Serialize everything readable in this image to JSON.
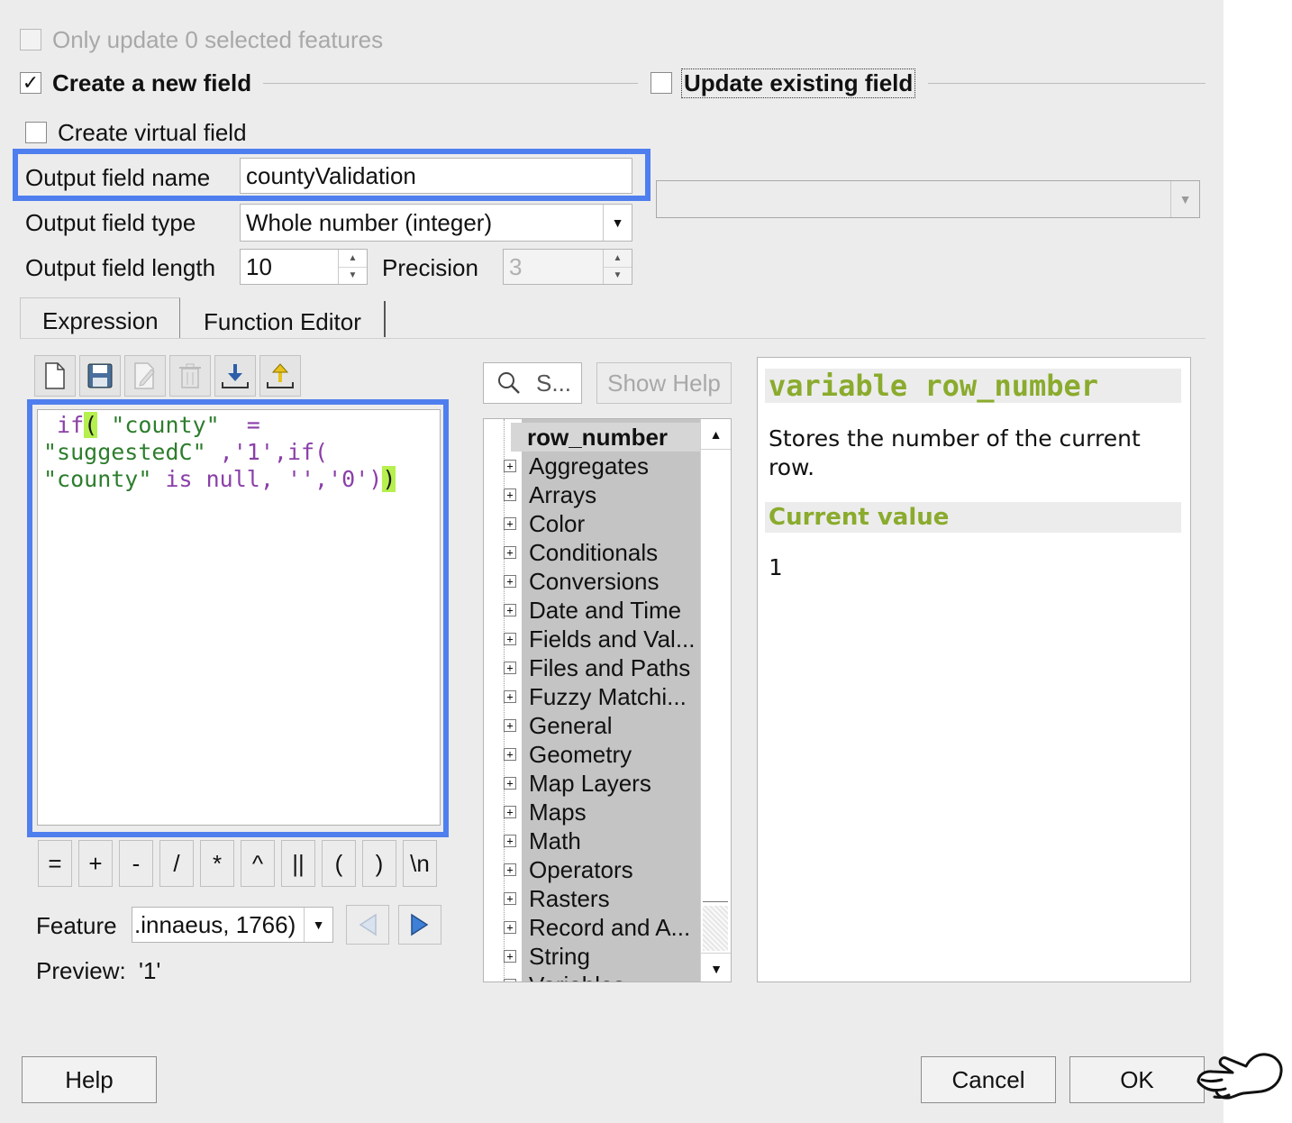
{
  "options": {
    "only_update_label": "Only update 0 selected features",
    "create_new_field_label": "Create a new field",
    "update_existing_label": "Update existing field",
    "create_virtual_label": "Create virtual field"
  },
  "output": {
    "name_label": "Output field name",
    "name_value": "countyValidation",
    "type_label": "Output field type",
    "type_value": "Whole number (integer)",
    "length_label": "Output field length",
    "length_value": "10",
    "precision_label": "Precision",
    "precision_value": "3"
  },
  "tabs": [
    "Expression",
    "Function Editor"
  ],
  "expression": {
    "line1_pre": " if",
    "line1_paren": "(",
    "line1_str": " \"county\"",
    "line1_op": "  =",
    "line2_a": "\"suggestedC\"",
    "line2_b": " ,'1',",
    "line2_c": "if(",
    "line3_a": "\"county\"",
    "line3_b": " is null,",
    "line3_c": " '','0')",
    "line3_close": ")"
  },
  "operators": [
    "=",
    "+",
    "-",
    "/",
    "*",
    "^",
    "||",
    "(",
    ")",
    "\\n"
  ],
  "feature": {
    "label": "Feature",
    "value": ".innaeus, 1766)"
  },
  "preview": {
    "label": "Preview:",
    "value": "'1'"
  },
  "search": {
    "placeholder": "S..."
  },
  "show_help_label": "Show Help",
  "tree": {
    "selected": "row_number",
    "groups": [
      "Aggregates",
      "Arrays",
      "Color",
      "Conditionals",
      "Conversions",
      "Date and Time",
      "Fields and Val...",
      "Files and Paths",
      "Fuzzy Matchi...",
      "General",
      "Geometry",
      "Map Layers",
      "Maps",
      "Math",
      "Operators",
      "Rasters",
      "Record and A...",
      "String",
      "Variables"
    ]
  },
  "help_panel": {
    "title": "variable row_number",
    "description": "Stores the number of the current row.",
    "current_value_heading": "Current value",
    "current_value": "1"
  },
  "buttons": {
    "help": "Help",
    "cancel": "Cancel",
    "ok": "OK"
  },
  "colors": {
    "highlight_blue": "#4f7fef",
    "help_heading": "#8aab2d",
    "paren_match": "#b6f04e"
  }
}
